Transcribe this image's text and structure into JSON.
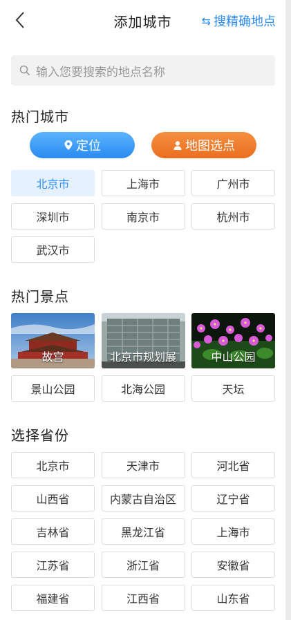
{
  "header": {
    "back_icon": "chevron-left-icon",
    "title": "添加城市",
    "precise_label": "搜精确地点",
    "precise_icon": "swap-arrows-icon"
  },
  "search": {
    "placeholder": "输入您要搜索的地点名称",
    "icon": "search-icon"
  },
  "hot_cities": {
    "title": "热门城市",
    "locate_label": "定位",
    "map_label": "地图选点",
    "locate_color": "#2a8af0",
    "map_color": "#ea6e1f",
    "items": [
      "北京市",
      "上海市",
      "广州市",
      "深圳市",
      "南京市",
      "杭州市",
      "武汉市"
    ],
    "active": "北京市"
  },
  "hot_spots": {
    "title": "热门景点",
    "photos": [
      "故宫",
      "北京市规划展",
      "中山公园"
    ],
    "items": [
      "景山公园",
      "北海公园",
      "天坛"
    ]
  },
  "provinces": {
    "title": "选择省份",
    "items": [
      "北京市",
      "天津市",
      "河北省",
      "山西省",
      "内蒙古自治区",
      "辽宁省",
      "吉林省",
      "黑龙江省",
      "上海市",
      "江苏省",
      "浙江省",
      "安徽省",
      "福建省",
      "江西省",
      "山东省"
    ]
  },
  "accent_color": "#2f8df5"
}
